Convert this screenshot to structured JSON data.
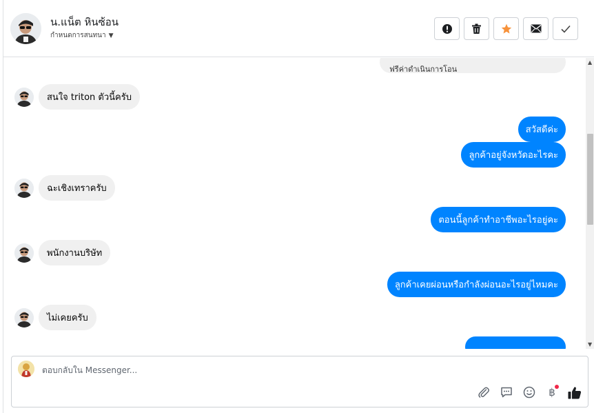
{
  "header": {
    "contact_name": "น.แน็ต หินซ้อน",
    "subtitle": "กำหนดการสนทนา",
    "actions": [
      {
        "name": "report-button",
        "icon": "alert-circle-icon"
      },
      {
        "name": "delete-button",
        "icon": "trash-icon"
      },
      {
        "name": "star-button",
        "icon": "star-icon"
      },
      {
        "name": "mark-unread-button",
        "icon": "envelope-icon"
      },
      {
        "name": "mark-done-button",
        "icon": "check-icon"
      }
    ]
  },
  "conversation": {
    "partial_top_text": "ฟรีค่าดำเนินการโอน",
    "messages": [
      {
        "side": "in",
        "text": "สนใจ triton ตัวนี้ครับ"
      },
      {
        "side": "out",
        "text": "สวัสดีค่ะ"
      },
      {
        "side": "out",
        "text": "ลูกค้าอยู่จังหวัดอะไรคะ"
      },
      {
        "side": "in",
        "text": "ฉะเชิงเทราครับ"
      },
      {
        "side": "out",
        "text": "ตอนนี้ลูกค้าทำอาชีพอะไรอยู่คะ"
      },
      {
        "side": "in",
        "text": "พนักงานบริษัท"
      },
      {
        "side": "out",
        "text": "ลูกค้าเคยผ่อนหรือกำลังผ่อนอะไรอยู่ไหมคะ"
      },
      {
        "side": "in",
        "text": "ไม่เคยครับ"
      }
    ]
  },
  "composer": {
    "placeholder": "ตอบกลับใน Messenger...",
    "tools": [
      "attachment-icon",
      "saved-reply-icon",
      "emoji-icon",
      "baht-payment-icon",
      "thumbs-up-icon"
    ],
    "baht_symbol": "฿"
  },
  "colors": {
    "outgoing_bubble": "#0084ff",
    "incoming_bubble": "#f0f0f0",
    "star": "#f7923b",
    "notification_dot": "#f02849"
  }
}
